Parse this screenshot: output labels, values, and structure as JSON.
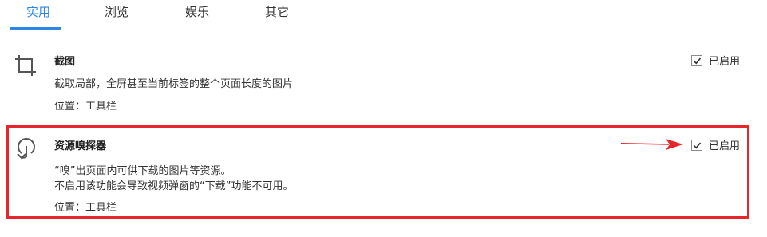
{
  "tabs": [
    {
      "label": "实用",
      "active": true
    },
    {
      "label": "浏览",
      "active": false
    },
    {
      "label": "娱乐",
      "active": false
    },
    {
      "label": "其它",
      "active": false
    }
  ],
  "extensions": [
    {
      "icon": "crop-icon",
      "title": "截图",
      "description": [
        "截取局部，全屏甚至当前标签的整个页面长度的图片"
      ],
      "position": "位置：工具栏",
      "enabled": true,
      "enabled_label": "已启用"
    },
    {
      "icon": "resource-sniffer-icon",
      "title": "资源嗅探器",
      "description": [
        "“嗅”出页面内可供下载的图片等资源。",
        "不启用该功能会导致视频弹窗的“下载”功能不可用。"
      ],
      "position": "位置：工具栏",
      "enabled": true,
      "enabled_label": "已启用"
    }
  ],
  "colors": {
    "accent": "#2b86e8",
    "annotation_red": "#e6262b"
  }
}
